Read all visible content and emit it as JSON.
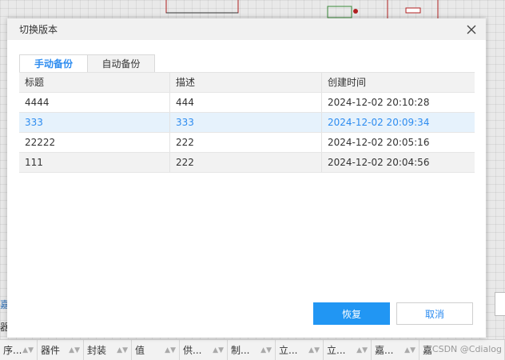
{
  "background": {
    "left_text_1": "嘉",
    "left_text_2": "器",
    "columns": [
      {
        "label": "序..."
      },
      {
        "label": "器件"
      },
      {
        "label": "封装"
      },
      {
        "label": "值"
      },
      {
        "label": "供..."
      },
      {
        "label": "制..."
      },
      {
        "label": "立..."
      },
      {
        "label": "立..."
      },
      {
        "label": "嘉..."
      },
      {
        "label": "嘉"
      }
    ],
    "watermark": "CSDN @Cdialog"
  },
  "dialog": {
    "title": "切换版本",
    "tabs": [
      {
        "label": "手动备份",
        "active": true
      },
      {
        "label": "自动备份",
        "active": false
      }
    ],
    "table": {
      "headers": [
        "标题",
        "描述",
        "创建时间"
      ],
      "rows": [
        [
          "4444",
          "444",
          "2024-12-02 20:10:28"
        ],
        [
          "333",
          "333",
          "2024-12-02 20:09:34"
        ],
        [
          "22222",
          "222",
          "2024-12-02 20:05:16"
        ],
        [
          "111",
          "222",
          "2024-12-02 20:04:56"
        ]
      ],
      "selected_row": 1
    },
    "buttons": {
      "confirm": "恢复",
      "cancel": "取消"
    }
  },
  "colors": {
    "accent": "#2196f3",
    "selected_row_bg": "#e6f2fc",
    "header_bg": "#f1f1f1"
  }
}
